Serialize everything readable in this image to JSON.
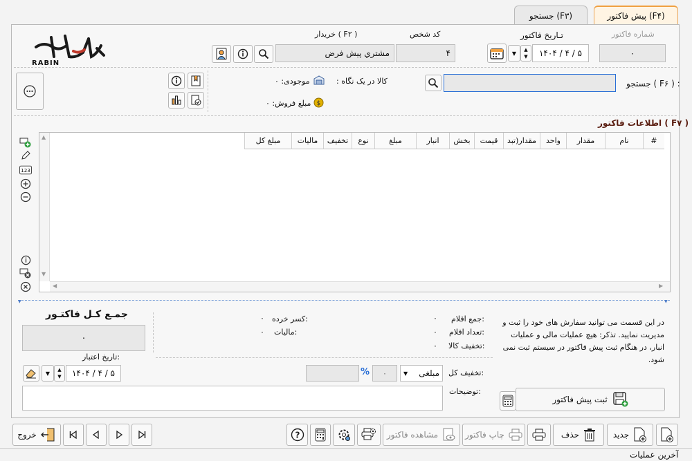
{
  "tabs": [
    {
      "label": "پیش فاکتور (F4)"
    },
    {
      "label": "جستجو (F3)"
    }
  ],
  "header": {
    "invoice_number_label": "شماره فاکتور",
    "invoice_number_value": "0",
    "invoice_date_label": "تـاریخ فاکتور",
    "invoice_date_value": "1404 / 4 / 5",
    "person_code_label": "کد شخص",
    "person_code_value": "4",
    "buyer_label": "خریدار ( F2 )",
    "buyer_value": "مشتري پيش فرض"
  },
  "logo": {
    "text": "RABIN"
  },
  "search": {
    "label": "جستجو ( F6 ) :",
    "value": "",
    "glance_label": ": کالا در یک نگاه",
    "stock_label": "موجودی: 0",
    "sale_amount_label": "مبلغ فروش: 0"
  },
  "invoice_info_title": "اطلاعات فاکتور ( F7 )",
  "grid_columns": [
    "#",
    "نام",
    "مقدار",
    "واحد",
    "مقدار(تبد",
    "قیمت",
    "بخش",
    "انبار",
    "مبلغ",
    "نوع",
    "تخفیف",
    "مالیات",
    "مبلغ کل"
  ],
  "summary": {
    "help_text": "در این قسمت می توانید سفارش های خود را ثبت و مدیریت نمایید. تذکر: هیچ عملیات مالی و عملیات انبار، در هنگام ثبت پیش فاکتور در سیستم ثبت نمی شود.",
    "items_sum_label": "جمع اقلام:",
    "items_sum_value": "0",
    "items_count_label": "تعداد اقلام:",
    "items_count_value": "0",
    "goods_discount_label": "تخفیف کالا:",
    "goods_discount_value": "0",
    "rounding_label": "کسر خرده:",
    "rounding_value": "0",
    "tax_label": "مالیات:",
    "tax_value": "0",
    "total_title": "جمـع کـل فاکتـور",
    "total_value": "0",
    "validity_label": "تاریخ اعتبار:",
    "validity_value": "1404 / 4 / 5",
    "total_discount_label": "تخفیف کل:",
    "discount_type": "مبلغی",
    "discount_value": "0",
    "percent_sign": "%",
    "notes_label": "توضیحات:",
    "notes_value": "",
    "register_button": "ثبت پیش فاکتور"
  },
  "toolbar": {
    "new": "جدید",
    "delete": "حذف",
    "print_invoice": "چاپ فاکتور",
    "view_invoice": "مشاهده فاکتور",
    "exit": "خروج"
  },
  "status": {
    "last_ops": "آخرین عملیات"
  },
  "colors": {
    "accent_orange": "#f0a040",
    "green": "#2e9e3e",
    "blue_focus": "#2a6fd6",
    "title_red": "#9b2b1a"
  }
}
